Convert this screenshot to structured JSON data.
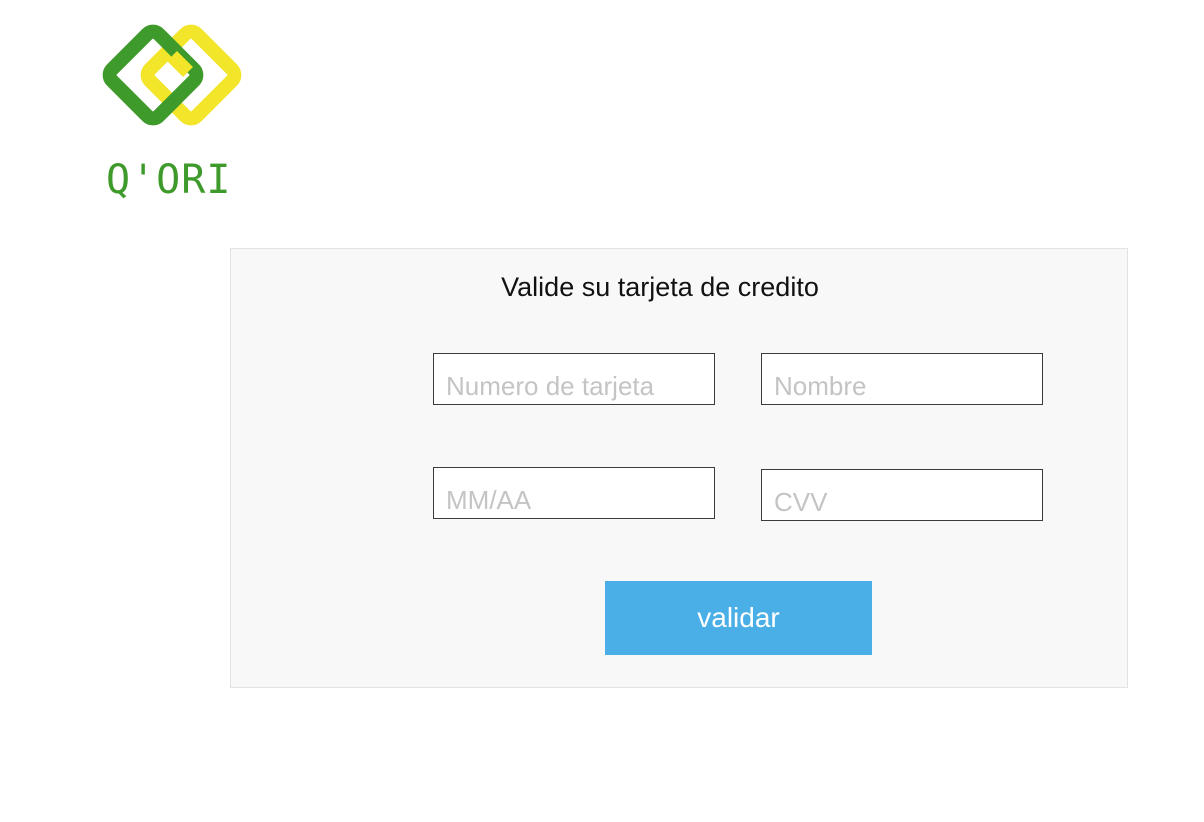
{
  "brand": {
    "name": "Q'ORI",
    "logo_icon": "interlocking-diamonds-logo",
    "colors": {
      "green": "#3e9a2a",
      "yellow": "#f2e52a"
    }
  },
  "card": {
    "title": "Valide su tarjeta de credito",
    "fields": {
      "card_number": {
        "placeholder": "Numero de tarjeta",
        "value": ""
      },
      "name": {
        "placeholder": "Nombre",
        "value": ""
      },
      "expiry": {
        "placeholder": "MM/AA",
        "value": ""
      },
      "cvv": {
        "placeholder": "CVV",
        "value": ""
      }
    },
    "submit_label": "validar",
    "accent_color": "#4aafe6"
  }
}
